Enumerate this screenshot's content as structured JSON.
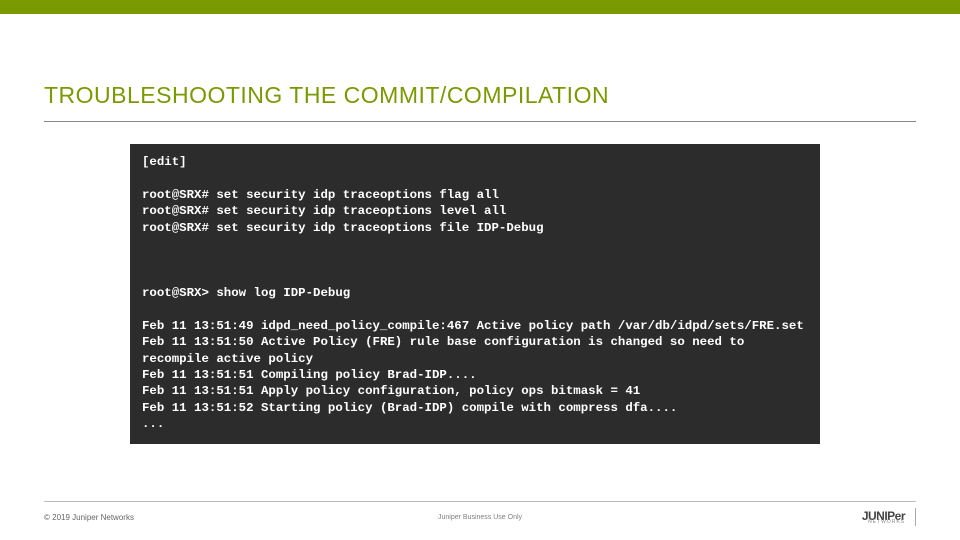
{
  "heading": "TROUBLESHOOTING THE COMMIT/COMPILATION",
  "terminal_text": "[edit]\n\nroot@SRX# set security idp traceoptions flag all\nroot@SRX# set security idp traceoptions level all\nroot@SRX# set security idp traceoptions file IDP-Debug\n\n\n\nroot@SRX> show log IDP-Debug\n\nFeb 11 13:51:49 idpd_need_policy_compile:467 Active policy path /var/db/idpd/sets/FRE.set\nFeb 11 13:51:50 Active Policy (FRE) rule base configuration is changed so need to recompile active policy\nFeb 11 13:51:51 Compiling policy Brad-IDP....\nFeb 11 13:51:51 Apply policy configuration, policy ops bitmask = 41\nFeb 11 13:51:52 Starting policy (Brad-IDP) compile with compress dfa....\n...",
  "footer": {
    "copyright": "© 2019 Juniper Networks",
    "center": "Juniper Business Use Only",
    "logo_name": "JUNIPer",
    "logo_sub": "NETWORKS"
  }
}
